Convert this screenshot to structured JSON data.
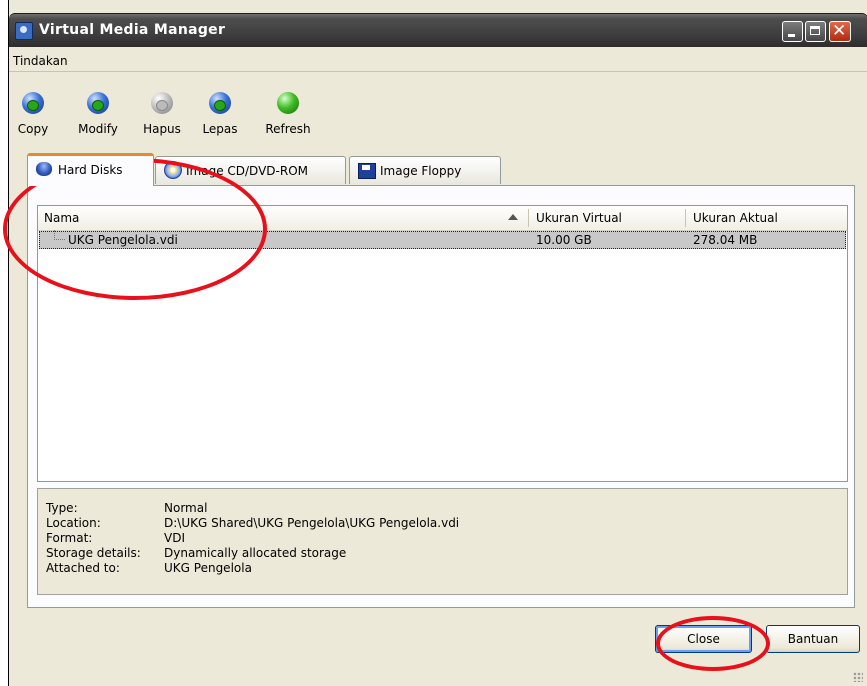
{
  "window": {
    "title": "Virtual Media Manager"
  },
  "menu": {
    "items": [
      "Tindakan"
    ]
  },
  "toolbar": {
    "copy": "Copy",
    "modify": "Modify",
    "hapus": "Hapus",
    "lepas": "Lepas",
    "refresh": "Refresh"
  },
  "tabs": {
    "hard_disks": "Hard Disks",
    "image_cd": "Image CD/DVD-ROM",
    "image_floppy": "Image Floppy"
  },
  "table": {
    "headers": {
      "nama": "Nama",
      "virtual": "Ukuran Virtual",
      "aktual": "Ukuran Aktual"
    },
    "rows": [
      {
        "nama": "UKG Pengelola.vdi",
        "virtual": "10.00 GB",
        "aktual": "278.04 MB"
      }
    ]
  },
  "details": {
    "type_key": "Type:",
    "type_val": "Normal",
    "location_key": "Location:",
    "location_val": "D:\\UKG Shared\\UKG Pengelola\\UKG Pengelola.vdi",
    "format_key": "Format:",
    "format_val": "VDI",
    "storage_key": "Storage details:",
    "storage_val": "Dynamically allocated storage",
    "attached_key": "Attached to:",
    "attached_val": "UKG Pengelola"
  },
  "buttons": {
    "close": "Close",
    "help": "Bantuan"
  },
  "colors": {
    "annotation": "#e8101a",
    "selection": "#c8c8c8",
    "active_tab": "#e68b2c"
  }
}
